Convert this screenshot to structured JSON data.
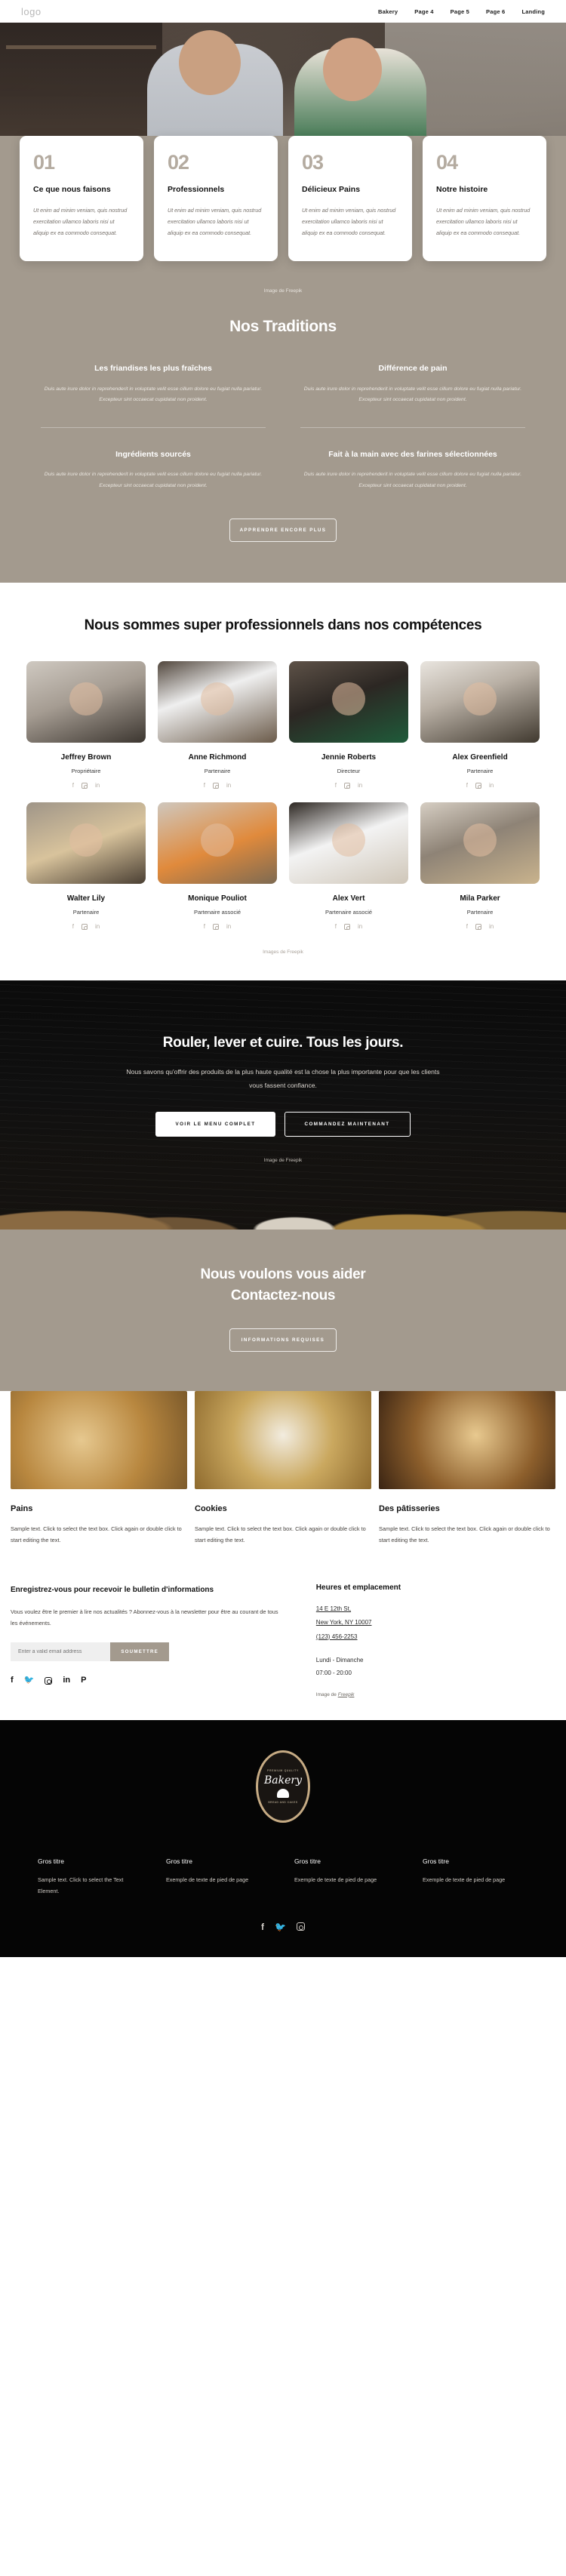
{
  "header": {
    "logo": "logo",
    "nav": [
      {
        "label": "Bakery"
      },
      {
        "label": "Page 4"
      },
      {
        "label": "Page 5"
      },
      {
        "label": "Page 6"
      },
      {
        "label": "Landing"
      }
    ]
  },
  "feature_cards": [
    {
      "num": "01",
      "title": "Ce que nous faisons",
      "text": "Ut enim ad minim veniam, quis nostrud exercitation ullamco laboris nisi ut aliquip ex ea commodo consequat."
    },
    {
      "num": "02",
      "title": "Professionnels",
      "text": "Ut enim ad minim veniam, quis nostrud exercitation ullamco laboris nisi ut aliquip ex ea commodo consequat."
    },
    {
      "num": "03",
      "title": "Délicieux Pains",
      "text": "Ut enim ad minim veniam, quis nostrud exercitation ullamco laboris nisi ut aliquip ex ea commodo consequat."
    },
    {
      "num": "04",
      "title": "Notre histoire",
      "text": "Ut enim ad minim veniam, quis nostrud exercitation ullamco laboris nisi ut aliquip ex ea commodo consequat."
    }
  ],
  "credits": {
    "hero": "Image de Freepik",
    "team": "Images de Freepik",
    "cta": "Image de Freepik",
    "contact_prefix": "Image de ",
    "contact_link": "Freepik"
  },
  "traditions": {
    "title": "Nos Traditions",
    "items": [
      {
        "title": "Les friandises les plus fraîches",
        "text": "Duis aute irure dolor in reprehenderit in voluptate velit esse cillum dolore eu fugiat nulla pariatur. Excepteur sint occaecat cupidatat non proident."
      },
      {
        "title": "Différence de pain",
        "text": "Duis aute irure dolor in reprehenderit in voluptate velit esse cillum dolore eu fugiat nulla pariatur. Excepteur sint occaecat cupidatat non proident."
      },
      {
        "title": "Ingrédients sourcés",
        "text": "Duis aute irure dolor in reprehenderit in voluptate velit esse cillum dolore eu fugiat nulla pariatur. Excepteur sint occaecat cupidatat non proident."
      },
      {
        "title": "Fait à la main avec des farines sélectionnées",
        "text": "Duis aute irure dolor in reprehenderit in voluptate velit esse cillum dolore eu fugiat nulla pariatur. Excepteur sint occaecat cupidatat non proident."
      }
    ],
    "button": "APPRENDRE ENCORE PLUS"
  },
  "team": {
    "heading": "Nous sommes super professionnels dans nos compétences",
    "members": [
      {
        "name": "Jeffrey Brown",
        "role": "Propriétaire"
      },
      {
        "name": "Anne Richmond",
        "role": "Partenaire"
      },
      {
        "name": "Jennie Roberts",
        "role": "Directeur"
      },
      {
        "name": "Alex Greenfield",
        "role": "Partenaire"
      },
      {
        "name": "Walter Lily",
        "role": "Partenaire"
      },
      {
        "name": "Monique Pouliot",
        "role": "Partenaire associé"
      },
      {
        "name": "Alex Vert",
        "role": "Partenaire associé"
      },
      {
        "name": "Mila Parker",
        "role": "Partenaire"
      }
    ]
  },
  "cta": {
    "title": "Rouler, lever et cuire. Tous les jours.",
    "text": "Nous savons qu'offrir des produits de la plus haute qualité est la chose la plus importante pour que les clients vous fassent confiance.",
    "primary": "VOIR LE MENU COMPLET",
    "secondary": "COMMANDEZ MAINTENANT"
  },
  "contact": {
    "title_line1": "Nous voulons vous aider",
    "title_line2": "Contactez-nous",
    "button": "INFORMATIONS REQUISES"
  },
  "products": [
    {
      "title": "Pains",
      "text": "Sample text. Click to select the text box. Click again or double click to start editing the text."
    },
    {
      "title": "Cookies",
      "text": "Sample text. Click to select the text box. Click again or double click to start editing the text."
    },
    {
      "title": "Des pâtisseries",
      "text": "Sample text. Click to select the text box. Click again or double click to start editing the text."
    }
  ],
  "newsletter": {
    "title": "Enregistrez-vous pour recevoir le bulletin d'informations",
    "text": "Vous voulez être le premier à lire nos actualités ? Abonnez-vous à la newsletter pour être au courant de tous les événements.",
    "placeholder": "Enter a valid email address",
    "input_value": "",
    "submit": "SOUMETTRE"
  },
  "location": {
    "title": "Heures et emplacement",
    "address_line1": "14 E 12th St,",
    "address_line2": "New York, NY 10007",
    "phone": "(123) 456-2253",
    "days": "Lundi - Dimanche",
    "hours": "07:00 - 20:00"
  },
  "footer": {
    "badge_top": "PREMIUM QUALITY",
    "badge_main": "Bakery",
    "badge_bottom": "BREAD AND CAKES",
    "columns": [
      {
        "title": "Gros titre",
        "text": "Sample text. Click to select the Text Element."
      },
      {
        "title": "Gros titre",
        "text": "Exemple de texte de pied de page"
      },
      {
        "title": "Gros titre",
        "text": "Exemple de texte de pied de page"
      },
      {
        "title": "Gros titre",
        "text": "Exemple de texte de pied de page"
      }
    ]
  }
}
